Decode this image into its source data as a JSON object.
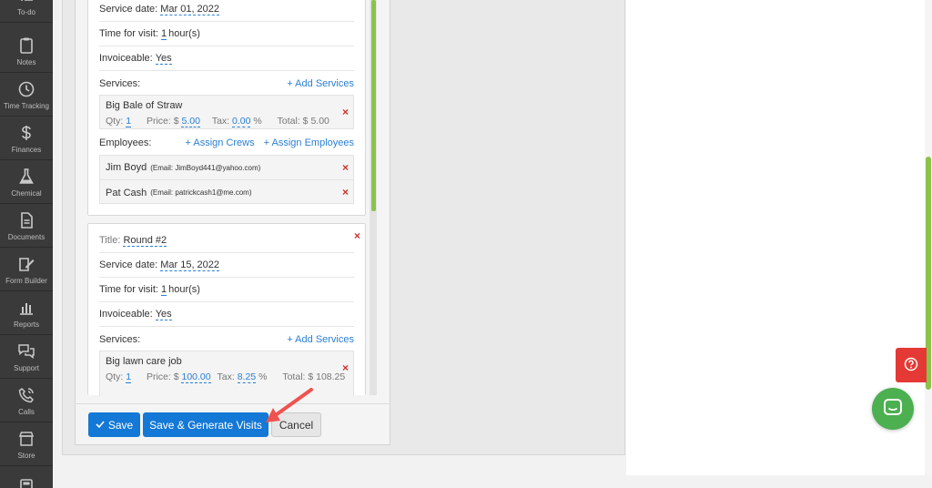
{
  "sidebar": {
    "items": [
      {
        "label": "To-do",
        "icon": "todo-list-icon"
      },
      {
        "label": "Notes",
        "icon": "clipboard-icon"
      },
      {
        "label": "Time Tracking",
        "icon": "clock-icon"
      },
      {
        "label": "Finances",
        "icon": "dollar-icon"
      },
      {
        "label": "Chemical",
        "icon": "flask-icon"
      },
      {
        "label": "Documents",
        "icon": "document-icon"
      },
      {
        "label": "Form Builder",
        "icon": "form-edit-icon"
      },
      {
        "label": "Reports",
        "icon": "bar-chart-icon"
      },
      {
        "label": "Support",
        "icon": "chat-bubbles-icon"
      },
      {
        "label": "Calls",
        "icon": "phone-icon"
      },
      {
        "label": "Store",
        "icon": "store-icon"
      }
    ]
  },
  "visit1": {
    "service_date_label": "Service date:",
    "service_date": "Mar 01, 2022",
    "time_label": "Time for visit:",
    "time_value": "1",
    "time_unit": "hour(s)",
    "invoiceable_label": "Invoiceable:",
    "invoiceable": "Yes",
    "services_label": "Services:",
    "add_services": "+ Add Services",
    "service": {
      "name": "Big Bale of Straw",
      "qty_label": "Qty:",
      "qty": "1",
      "price_label": "Price: $",
      "price": "5.00",
      "tax_label": "Tax:",
      "tax": "0.00",
      "tax_unit": "%",
      "total_label": "Total: $",
      "total": "5.00"
    },
    "employees_label": "Employees:",
    "assign_crews": "+ Assign Crews",
    "assign_employees": "+ Assign Employees",
    "employees": [
      {
        "name": "Jim Boyd",
        "email": "(Email: JimBoyd441@yahoo.com)"
      },
      {
        "name": "Pat Cash",
        "email": "(Email: patrickcash1@me.com)"
      }
    ]
  },
  "visit2": {
    "title_label": "Title:",
    "title": "Round #2",
    "service_date_label": "Service date:",
    "service_date": "Mar 15, 2022",
    "time_label": "Time for visit:",
    "time_value": "1",
    "time_unit": "hour(s)",
    "invoiceable_label": "Invoiceable:",
    "invoiceable": "Yes",
    "services_label": "Services:",
    "add_services": "+ Add Services",
    "service": {
      "name": "Big lawn care job",
      "qty_label": "Qty:",
      "qty": "1",
      "price_label": "Price: $",
      "price": "100.00",
      "tax_label": "Tax:",
      "tax": "8.25",
      "tax_unit": "%",
      "total_label": "Total: $",
      "total": "108.25"
    }
  },
  "footer": {
    "save": "Save",
    "save_generate": "Save & Generate Visits",
    "cancel": "Cancel"
  },
  "colors": {
    "primary": "#1478d6",
    "accent_green": "#8bc34a",
    "danger": "#d32f2f",
    "arrow": "#ef5350"
  }
}
